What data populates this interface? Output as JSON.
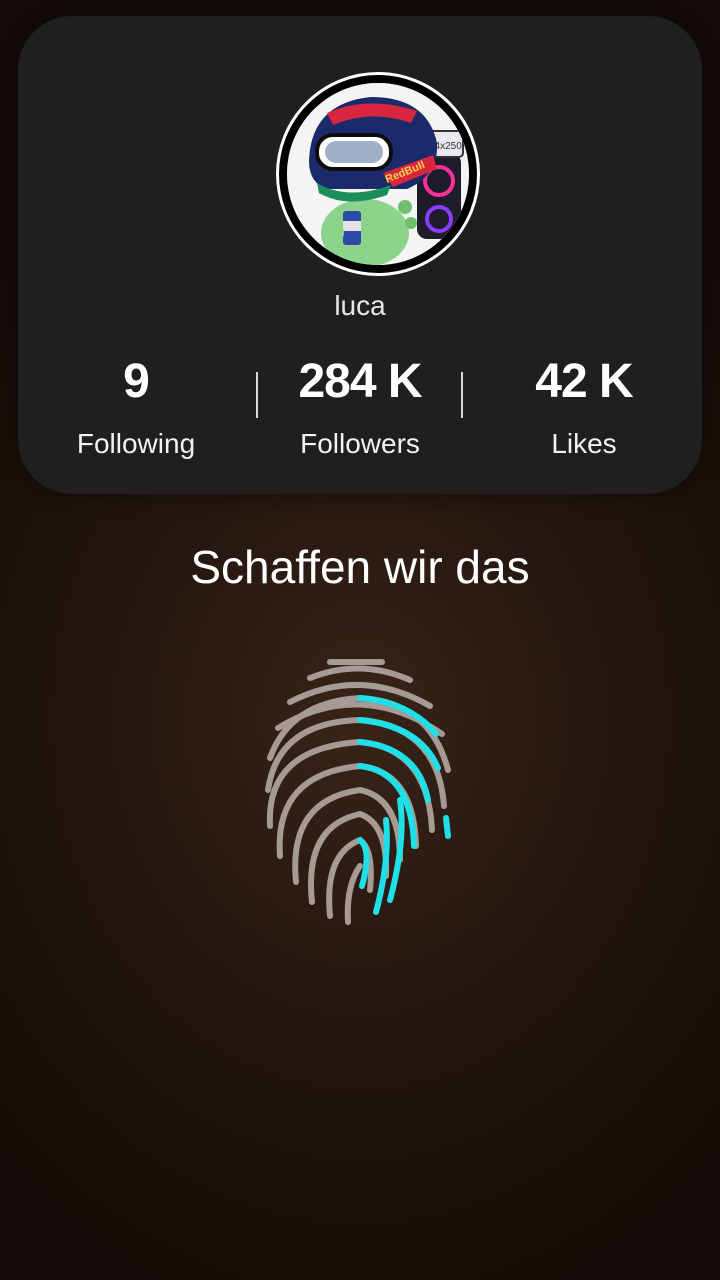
{
  "profile": {
    "username": "luca",
    "avatar_icon": "avatar-dinosaur-helmet-icon",
    "avatar_text": "24x250",
    "stats": [
      {
        "value": "9",
        "label": "Following"
      },
      {
        "value": "284 K",
        "label": "Followers"
      },
      {
        "value": "42 K",
        "label": "Likes"
      }
    ]
  },
  "headline": "Schaffen wir das",
  "fingerprint": {
    "icon": "fingerprint-icon",
    "base_color": "#a59a94",
    "progress_color": "#1fe0e8"
  }
}
